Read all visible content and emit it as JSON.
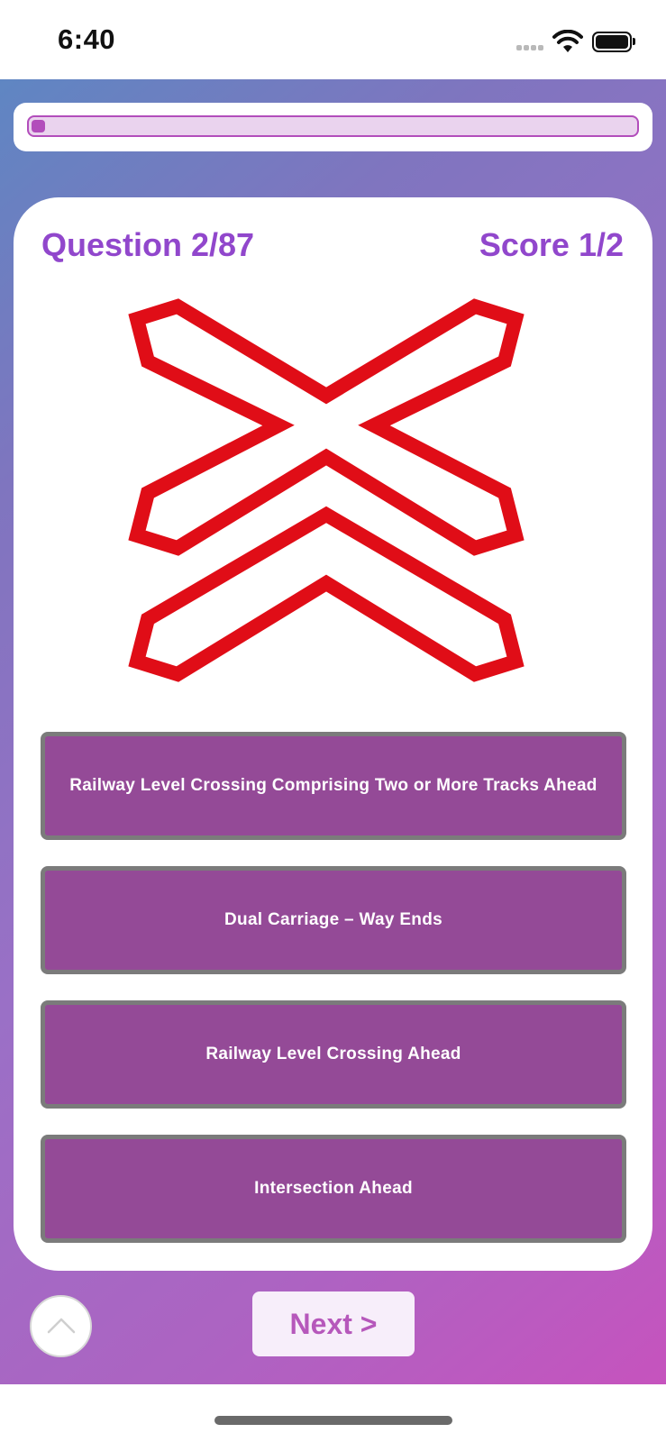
{
  "status_bar": {
    "time": "6:40"
  },
  "progress": {
    "current": 2,
    "total": 87,
    "fraction": 0.023,
    "color": "#b24dbb"
  },
  "quiz": {
    "question_label": "Question 2/87",
    "score_label": "Score 1/2",
    "sign_image": {
      "icon": "railway-level-crossing-multiple-tracks-sign-icon",
      "stroke_color": "#e00d17"
    },
    "answers": [
      {
        "label": "Railway Level Crossing Comprising Two or More Tracks Ahead"
      },
      {
        "label": "Dual Carriage – Way Ends"
      },
      {
        "label": "Railway Level Crossing Ahead"
      },
      {
        "label": "Intersection Ahead"
      }
    ]
  },
  "controls": {
    "scroll_up_icon": "chevron-up-icon",
    "next_label": "Next >"
  },
  "colors": {
    "accent": "#9147cc",
    "answer_bg": "#944a97",
    "answer_border": "#7b7b7b",
    "next_text": "#b658bb"
  }
}
